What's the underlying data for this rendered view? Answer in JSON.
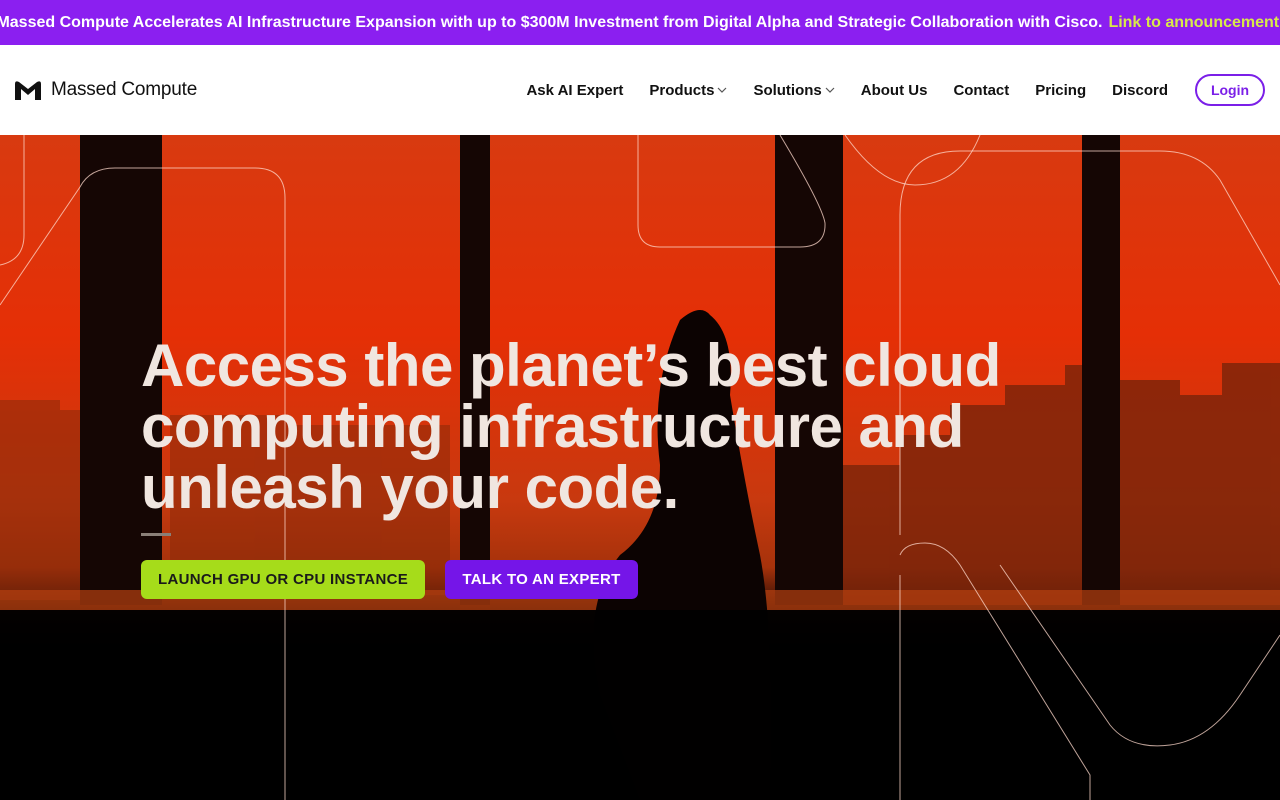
{
  "announcement": {
    "text": "Massed Compute Accelerates AI Infrastructure Expansion with up to $300M Investment from Digital Alpha and Strategic Collaboration with Cisco.",
    "link_label": "Link to announcement."
  },
  "brand": {
    "name": "Massed Compute",
    "icon": "massed-compute-logo-icon"
  },
  "nav": {
    "items": [
      "Ask AI Expert",
      "Products",
      "Solutions",
      "About Us",
      "Contact",
      "Pricing",
      "Discord"
    ],
    "login_label": "Login"
  },
  "hero": {
    "title": "Access the planet’s best cloud computing infrastructure and unleash your code.",
    "primary_button": "LAUNCH GPU OR CPU INSTANCE",
    "secondary_button": "TALK TO AN EXPERT"
  },
  "colors": {
    "announcement_bg": "#8b1ff0",
    "announcement_link": "#d8e84a",
    "accent_purple": "#7515e8",
    "accent_green": "#a6dc1a",
    "hero_red": "#e52f06"
  }
}
